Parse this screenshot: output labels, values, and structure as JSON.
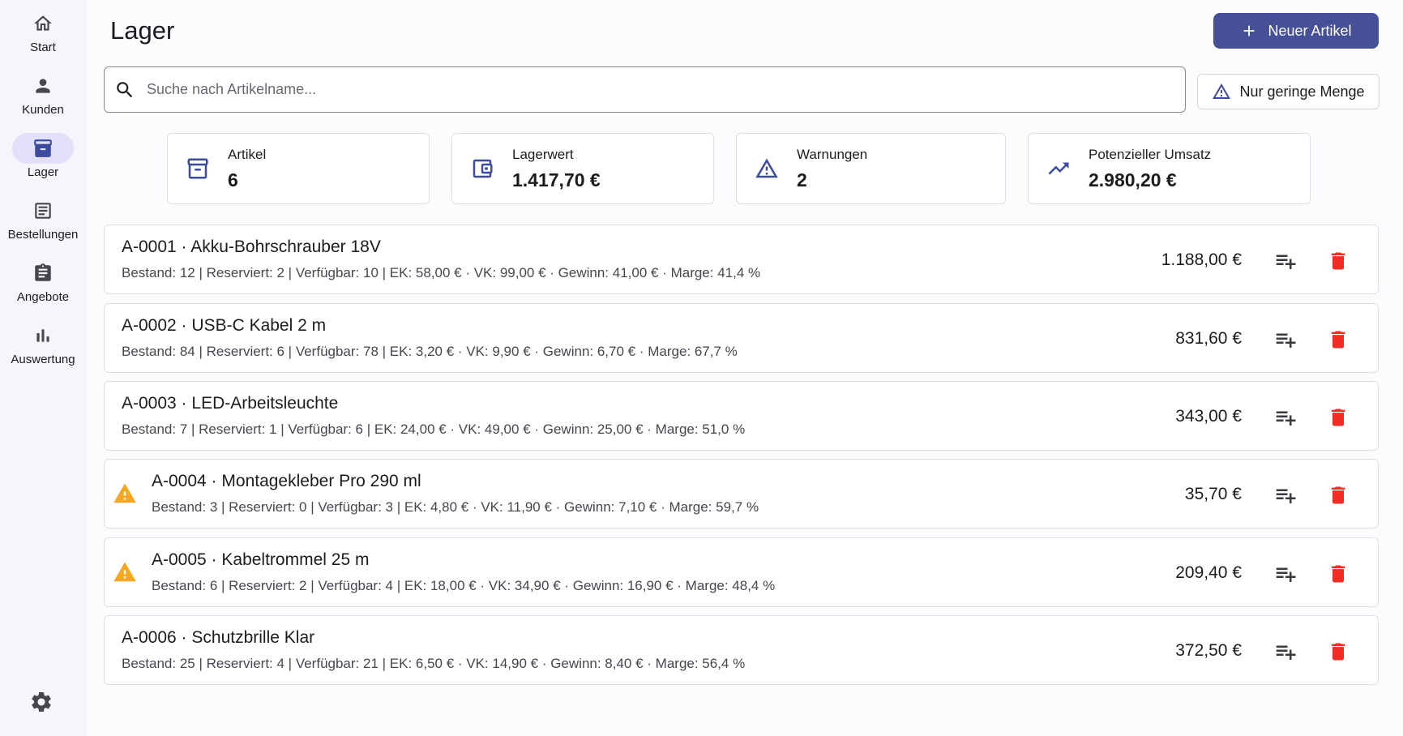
{
  "sidebar": {
    "items": [
      {
        "label": "Start",
        "icon": "home-icon"
      },
      {
        "label": "Kunden",
        "icon": "person-icon"
      },
      {
        "label": "Lager",
        "icon": "inventory-icon",
        "active": true
      },
      {
        "label": "Bestellungen",
        "icon": "receipt-icon"
      },
      {
        "label": "Angebote",
        "icon": "clipboard-icon"
      },
      {
        "label": "Auswertung",
        "icon": "bar-chart-icon"
      }
    ],
    "settings_icon": "gear-icon"
  },
  "header": {
    "title": "Lager",
    "new_button_label": "Neuer Artikel"
  },
  "search": {
    "placeholder": "Suche nach Artikelname...",
    "value": ""
  },
  "filter": {
    "label": "Nur geringe Menge"
  },
  "stats": [
    {
      "label": "Artikel",
      "value": "6",
      "icon": "inventory-icon"
    },
    {
      "label": "Lagerwert",
      "value": "1.417,70 €",
      "icon": "wallet-icon"
    },
    {
      "label": "Warnungen",
      "value": "2",
      "icon": "warning-icon"
    },
    {
      "label": "Potenzieller Umsatz",
      "value": "2.980,20 €",
      "icon": "trending-up-icon"
    }
  ],
  "articles": [
    {
      "id": "A-0001",
      "name": "Akku-Bohrschrauber 18V",
      "warning": false,
      "meta": "Bestand: 12 | Reserviert: 2 | Verfügbar: 10 | EK: 58,00 € · VK: 99,00 € · Gewinn: 41,00 € · Marge: 41,4 %",
      "total": "1.188,00 €"
    },
    {
      "id": "A-0002",
      "name": "USB-C Kabel 2 m",
      "warning": false,
      "meta": "Bestand: 84 | Reserviert: 6 | Verfügbar: 78 | EK: 3,20 € · VK: 9,90 € · Gewinn: 6,70 € · Marge: 67,7 %",
      "total": "831,60 €"
    },
    {
      "id": "A-0003",
      "name": "LED-Arbeitsleuchte",
      "warning": false,
      "meta": "Bestand: 7 | Reserviert: 1 | Verfügbar: 6 | EK: 24,00 € · VK: 49,00 € · Gewinn: 25,00 € · Marge: 51,0 %",
      "total": "343,00 €"
    },
    {
      "id": "A-0004",
      "name": "Montagekleber Pro 290 ml",
      "warning": true,
      "meta": "Bestand: 3 | Reserviert: 0 | Verfügbar: 3 | EK: 4,80 € · VK: 11,90 € · Gewinn: 7,10 € · Marge: 59,7 %",
      "total": "35,70 €"
    },
    {
      "id": "A-0005",
      "name": "Kabeltrommel 25 m",
      "warning": true,
      "meta": "Bestand: 6 | Reserviert: 2 | Verfügbar: 4 | EK: 18,00 € · VK: 34,90 € · Gewinn: 16,90 € · Marge: 48,4 %",
      "total": "209,40 €"
    },
    {
      "id": "A-0006",
      "name": "Schutzbrille Klar",
      "warning": false,
      "meta": "Bestand: 25 | Reserviert: 4 | Verfügbar: 21 | EK: 6,50 € · VK: 14,90 € · Gewinn: 8,40 € · Marge: 56,4 %",
      "total": "372,50 €"
    }
  ],
  "colors": {
    "primary": "#465096",
    "warning": "#f5a623",
    "delete": "#f02d22"
  }
}
